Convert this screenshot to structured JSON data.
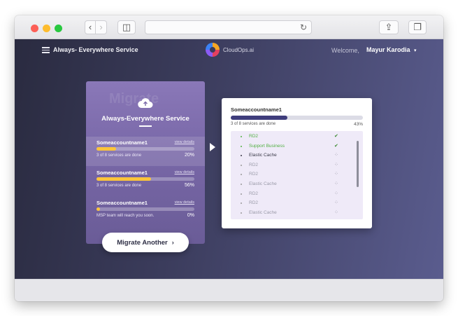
{
  "browser": {
    "back_glyph": "‹",
    "forward_glyph": "›",
    "sidebar_glyph": "◫",
    "share_glyph": "⇪",
    "tabs_glyph": "❐",
    "reload_glyph": "↻",
    "url": ""
  },
  "header": {
    "service_title": "Always- Everywhere Service",
    "logo_text": "CloudOps.ai",
    "welcome_label": "Welcome,",
    "username": "Mayur Karodia",
    "caret": "▾"
  },
  "left_card": {
    "watermark": "Migrate",
    "title": "Always-Everywhere Service",
    "accounts": [
      {
        "name": "Someaccountname1",
        "link": "view details",
        "status": "3 of 8 services are done",
        "percent_label": "20%",
        "progress": 0.2
      },
      {
        "name": "Someaccountname1",
        "link": "view details",
        "status": "3 of 8 services are done",
        "percent_label": "56%",
        "progress": 0.56
      },
      {
        "name": "Someaccountname1",
        "link": "view details",
        "status": "MSP team will reach you soon.",
        "percent_label": "0%",
        "progress": 0.0
      }
    ]
  },
  "migrate_button": {
    "label": "Migrate Another",
    "chevron": "›"
  },
  "detail_panel": {
    "account_name": "Someaccountname1",
    "status": "3 of 8 services are done",
    "percent_label": "43%",
    "progress": 0.43,
    "services": [
      {
        "name": "RD2",
        "state": "done",
        "icon": "✔"
      },
      {
        "name": "Support Business",
        "state": "done",
        "icon": "✔"
      },
      {
        "name": "Elastic Cache",
        "state": "running",
        "icon": "⁘"
      },
      {
        "name": "RD2",
        "state": "pending",
        "icon": "⁘"
      },
      {
        "name": "RD2",
        "state": "pending",
        "icon": "⁘"
      },
      {
        "name": "Elastic Cache",
        "state": "pending",
        "icon": "⁘"
      },
      {
        "name": "RD2",
        "state": "pending",
        "icon": "⁘"
      },
      {
        "name": "RD2",
        "state": "pending",
        "icon": "⁘"
      },
      {
        "name": "Elastic Cache",
        "state": "pending",
        "icon": "⁘"
      }
    ]
  },
  "colors": {
    "progress_yellow": "#fbc43a",
    "progress_dark": "#3f3d7c",
    "done_green": "#52b043"
  }
}
